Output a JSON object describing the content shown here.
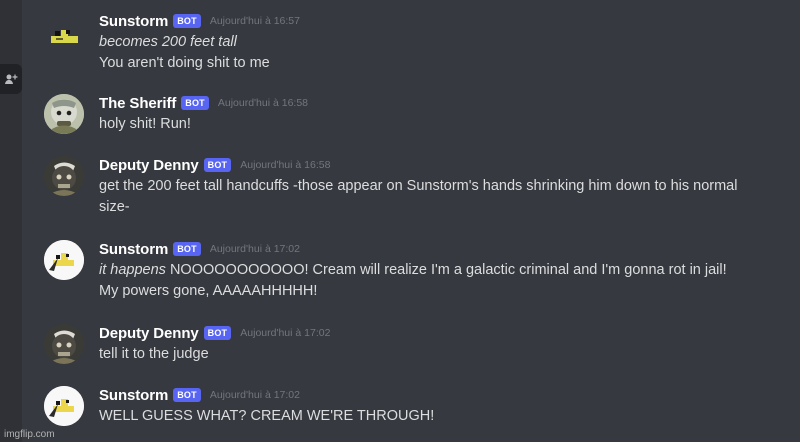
{
  "colors": {
    "background": "#36393f",
    "rail": "#2f3136",
    "username": "#ffffff",
    "message_text": "#dcddde",
    "timestamp": "#72767d",
    "bot_badge": "#5865f2"
  },
  "sidebar": {
    "add_member_icon": "add-member-icon"
  },
  "messages": [
    {
      "author": "Sunstorm",
      "badge": "BOT",
      "timestamp": "Aujourd'hui à 16:57",
      "lines": [
        "becomes 200 feet tall",
        "You aren't doing shit to me"
      ]
    },
    {
      "author": "The Sheriff",
      "badge": "BOT",
      "timestamp": "Aujourd'hui à 16:58",
      "lines": [
        "holy shit! Run!"
      ]
    },
    {
      "author": "Deputy Denny",
      "badge": "BOT",
      "timestamp": "Aujourd'hui à 16:58",
      "lines": [
        "get the 200 feet tall handcuffs -those appear on Sunstorm's hands shrinking him down to his normal",
        "size-"
      ]
    },
    {
      "author": "Sunstorm",
      "badge": "BOT",
      "timestamp": "Aujourd'hui à 17:02",
      "italic_prefix": "it happens",
      "lines": [
        " NOOOOOOOOOOO! Cream will realize I'm a galactic criminal and I'm gonna rot in jail!",
        "My powers gone, AAAAAHHHHH!"
      ]
    },
    {
      "author": "Deputy Denny",
      "badge": "BOT",
      "timestamp": "Aujourd'hui à 17:02",
      "lines": [
        "tell it to the judge"
      ]
    },
    {
      "author": "Sunstorm",
      "badge": "BOT",
      "timestamp": "Aujourd'hui à 17:02",
      "lines": [
        "WELL GUESS WHAT? CREAM WE'RE THROUGH!"
      ]
    }
  ],
  "watermark": "imgflip.com"
}
